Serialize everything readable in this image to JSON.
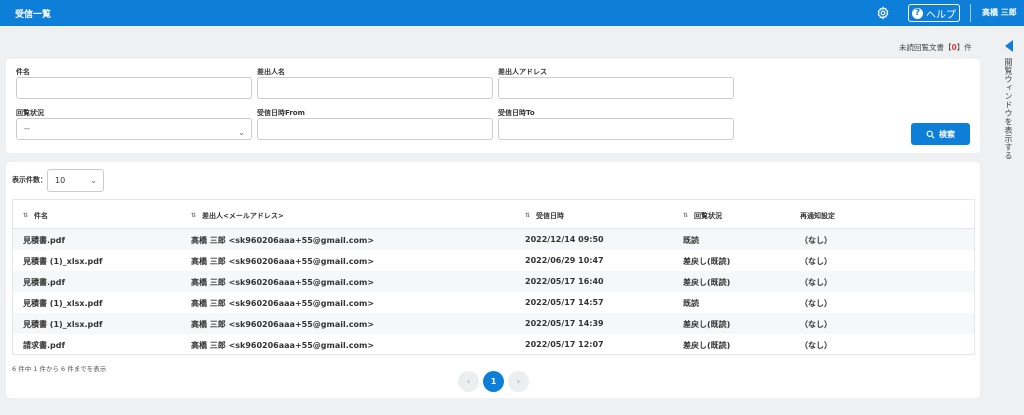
{
  "header": {
    "title": "受信一覧",
    "help_label": "ヘルプ",
    "user_name": "高橋 三郎"
  },
  "unread": {
    "prefix": "未読回覧文書【",
    "count": "0",
    "suffix": "】件"
  },
  "side_panel": {
    "label": "閲覧ウィンドウを表示する"
  },
  "filters": {
    "subject_label": "件名",
    "sender_name_label": "差出人名",
    "sender_address_label": "差出人アドレス",
    "status_label": "回覧状況",
    "status_value": "--",
    "date_from_label": "受信日時From",
    "date_to_label": "受信日時To",
    "search_button": "検索"
  },
  "results": {
    "count_label": "表示件数：",
    "count_value": "10",
    "columns": [
      "件名",
      "差出人<メールアドレス>",
      "受信日時",
      "回覧状況",
      "再通知設定"
    ],
    "rows": [
      {
        "subject": "見積書.pdf",
        "sender": "高橋 三郎 <sk960206aaa+55@gmail.com>",
        "date": "2022/12/14 09:50",
        "status": "既読",
        "renotify": "（なし）"
      },
      {
        "subject": "見積書 (1)_xlsx.pdf",
        "sender": "高橋 三郎 <sk960206aaa+55@gmail.com>",
        "date": "2022/06/29 10:47",
        "status": "差戻し(既読)",
        "renotify": "（なし）"
      },
      {
        "subject": "見積書.pdf",
        "sender": "高橋 三郎 <sk960206aaa+55@gmail.com>",
        "date": "2022/05/17 16:40",
        "status": "差戻し(既読)",
        "renotify": "（なし）"
      },
      {
        "subject": "見積書 (1)_xlsx.pdf",
        "sender": "高橋 三郎 <sk960206aaa+55@gmail.com>",
        "date": "2022/05/17 14:57",
        "status": "既読",
        "renotify": "（なし）"
      },
      {
        "subject": "見積書 (1)_xlsx.pdf",
        "sender": "高橋 三郎 <sk960206aaa+55@gmail.com>",
        "date": "2022/05/17 14:39",
        "status": "差戻し(既読)",
        "renotify": "（なし）"
      },
      {
        "subject": "請求書.pdf",
        "sender": "高橋 三郎 <sk960206aaa+55@gmail.com>",
        "date": "2022/05/17 12:07",
        "status": "差戻し(既読)",
        "renotify": "（なし）"
      }
    ],
    "summary": "6 件中 1 件から 6 件までを表示",
    "pagination": {
      "prev": "‹",
      "current": "1",
      "next": "›"
    }
  },
  "colors": {
    "primary": "#0d7fd8",
    "unread_count": "#e53935",
    "background": "#eef0f2"
  },
  "icons": {
    "settings": "gear-icon",
    "help": "question-circle-icon",
    "search": "search-icon",
    "side_toggle": "caret-left-icon",
    "sort": "sort-icon"
  }
}
